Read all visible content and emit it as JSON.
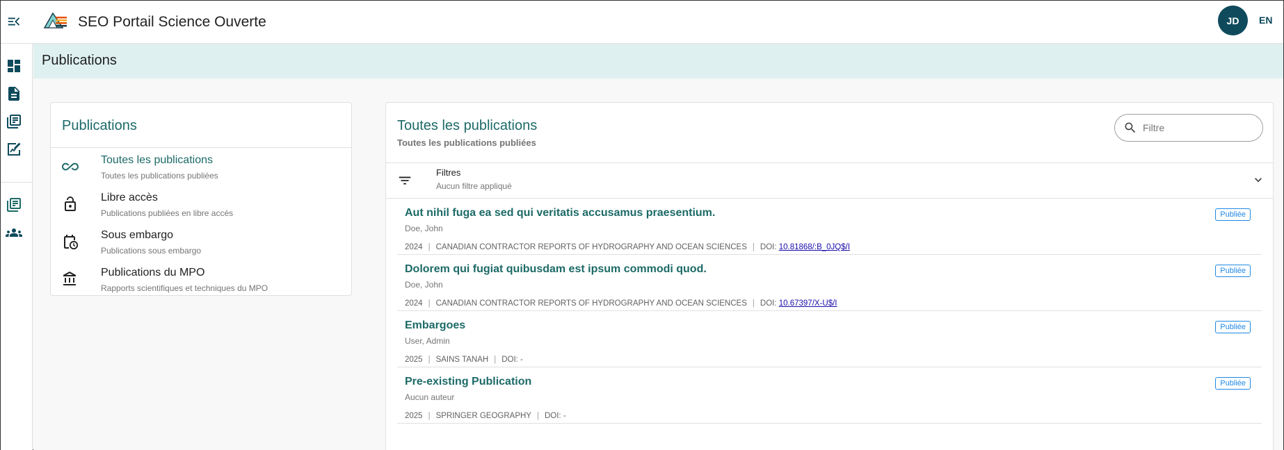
{
  "app": {
    "title": "SEO Portail Science Ouverte",
    "user_initials": "JD",
    "language_toggle": "EN"
  },
  "header": {
    "title": "Publications"
  },
  "left_panel": {
    "title": "Publications",
    "items": [
      {
        "label": "Toutes les publications",
        "subtitle": "Toutes les publications publiées",
        "icon": "infinity-icon",
        "active": true
      },
      {
        "label": "Libre accès",
        "subtitle": "Publications publiées en libre accès",
        "icon": "lock-open-icon",
        "active": false
      },
      {
        "label": "Sous embargo",
        "subtitle": "Publications sous embargo",
        "icon": "calendar-clock-icon",
        "active": false
      },
      {
        "label": "Publications du MPO",
        "subtitle": "Rapports scientifiques et techniques du MPO",
        "icon": "bank-icon",
        "active": false
      }
    ]
  },
  "main": {
    "title": "Toutes les publications",
    "subtitle": "Toutes les publications publiées",
    "filter_placeholder": "Filtre",
    "filters": {
      "label": "Filtres",
      "status": "Aucun filtre appliqué"
    },
    "publications": [
      {
        "title": "Aut nihil fuga ea sed qui veritatis accusamus praesentium.",
        "authors": "Doe, John",
        "year": "2024",
        "journal": "CANADIAN CONTRACTOR REPORTS OF HYDROGRAPHY AND OCEAN SCIENCES",
        "doi_label": "DOI:",
        "doi": "10.81868/:B_0JQ$/I",
        "status": "Publiée"
      },
      {
        "title": "Dolorem qui fugiat quibusdam est ipsum commodi quod.",
        "authors": "Doe, John",
        "year": "2024",
        "journal": "CANADIAN CONTRACTOR REPORTS OF HYDROGRAPHY AND OCEAN SCIENCES",
        "doi_label": "DOI:",
        "doi": "10.67397/X-U$/I",
        "status": "Publiée"
      },
      {
        "title": "Embargoes",
        "authors": "User, Admin",
        "year": "2025",
        "journal": "SAINS TANAH",
        "doi_label": "DOI: -",
        "doi": "",
        "status": "Publiée"
      },
      {
        "title": "Pre-existing Publication",
        "authors": "Aucun auteur",
        "year": "2025",
        "journal": "SPRINGER GEOGRAPHY",
        "doi_label": "DOI: -",
        "doi": "",
        "status": "Publiée"
      }
    ]
  },
  "colors": {
    "accent": "#1c6a67",
    "header_bg": "#dff0f0",
    "avatar_bg": "#0e4a5c",
    "badge": "#1e88e5",
    "link": "#1a0dab"
  }
}
